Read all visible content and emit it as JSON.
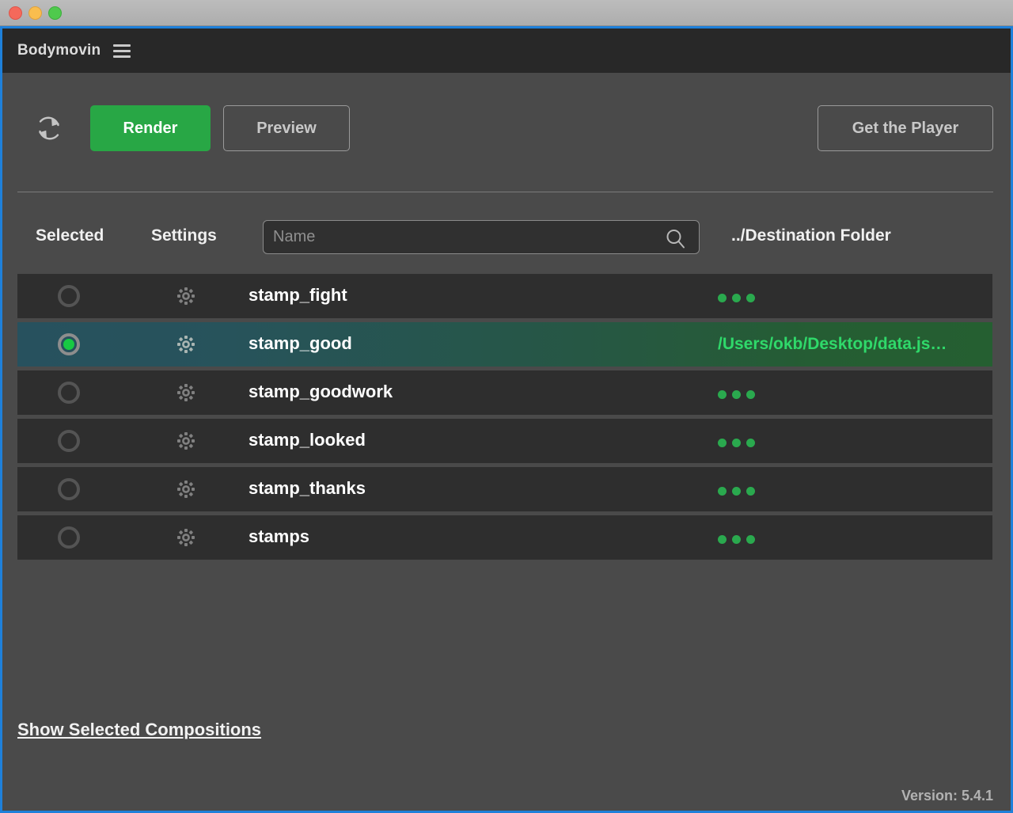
{
  "window": {
    "traffic_lights": [
      "close",
      "minimize",
      "maximize"
    ]
  },
  "app": {
    "title": "Bodymovin",
    "menu_icon": "hamburger-menu-icon",
    "version": "Version: 5.4.1"
  },
  "toolbar": {
    "refresh_icon": "refresh-icon",
    "render_label": "Render",
    "preview_label": "Preview",
    "get_player_label": "Get the Player",
    "render_color": "#28a745"
  },
  "table": {
    "headers": {
      "selected": "Selected",
      "settings": "Settings",
      "destination": "../Destination Folder"
    },
    "search": {
      "value": "",
      "placeholder": "Name",
      "icon": "search-icon"
    },
    "rows": [
      {
        "name": "stamp_fight",
        "selected": false,
        "destination": "",
        "dest_icon": "ellipsis-icon"
      },
      {
        "name": "stamp_good",
        "selected": true,
        "destination": "/Users/okb/Desktop/data.js…",
        "dest_icon": ""
      },
      {
        "name": "stamp_goodwork",
        "selected": false,
        "destination": "",
        "dest_icon": "ellipsis-icon"
      },
      {
        "name": "stamp_looked",
        "selected": false,
        "destination": "",
        "dest_icon": "ellipsis-icon"
      },
      {
        "name": "stamp_thanks",
        "selected": false,
        "destination": "",
        "dest_icon": "ellipsis-icon"
      },
      {
        "name": "stamps",
        "selected": false,
        "destination": "",
        "dest_icon": "ellipsis-icon"
      }
    ]
  },
  "footer": {
    "show_selected_label": "Show Selected Compositions"
  },
  "colors": {
    "accent_green": "#28a745",
    "path_green": "#2fd96a",
    "selected_row_left": "#27515e",
    "selected_row_right": "#255f31",
    "focus_border": "#1e80da"
  }
}
